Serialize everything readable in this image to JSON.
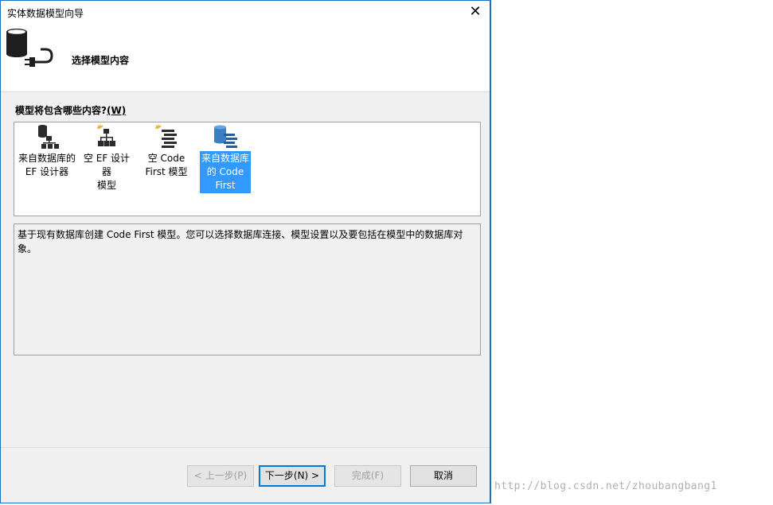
{
  "window": {
    "title": "实体数据模型向导",
    "close_glyph": "✕"
  },
  "header": {
    "title": "选择模型内容"
  },
  "question": {
    "label": "模型将包含哪些内容?",
    "accesskey": "(W)"
  },
  "options": [
    {
      "line1": "来自数据库的",
      "line2": "EF 设计器",
      "line3": "",
      "icon": "database-diagram-icon",
      "selected": false
    },
    {
      "line1": "空 EF 设计器",
      "line2": "模型",
      "line3": "",
      "icon": "empty-diagram-icon",
      "selected": false
    },
    {
      "line1": "空 Code",
      "line2": "First 模型",
      "line3": "",
      "icon": "empty-code-first-icon",
      "selected": false
    },
    {
      "line1": "来自数据库",
      "line2": "的 Code",
      "line3": "First",
      "icon": "database-code-first-icon",
      "selected": true
    }
  ],
  "description": "基于现有数据库创建 Code First 模型。您可以选择数据库连接、模型设置以及要包括在模型中的数据库对象。",
  "buttons": {
    "back": "< 上一步(P)",
    "next": "下一步(N) >",
    "finish": "完成(F)",
    "cancel": "取消"
  },
  "watermark": "http://blog.csdn.net/zhoubangbang1",
  "colors": {
    "accent": "#3399ff",
    "border": "#1b6fc9"
  }
}
